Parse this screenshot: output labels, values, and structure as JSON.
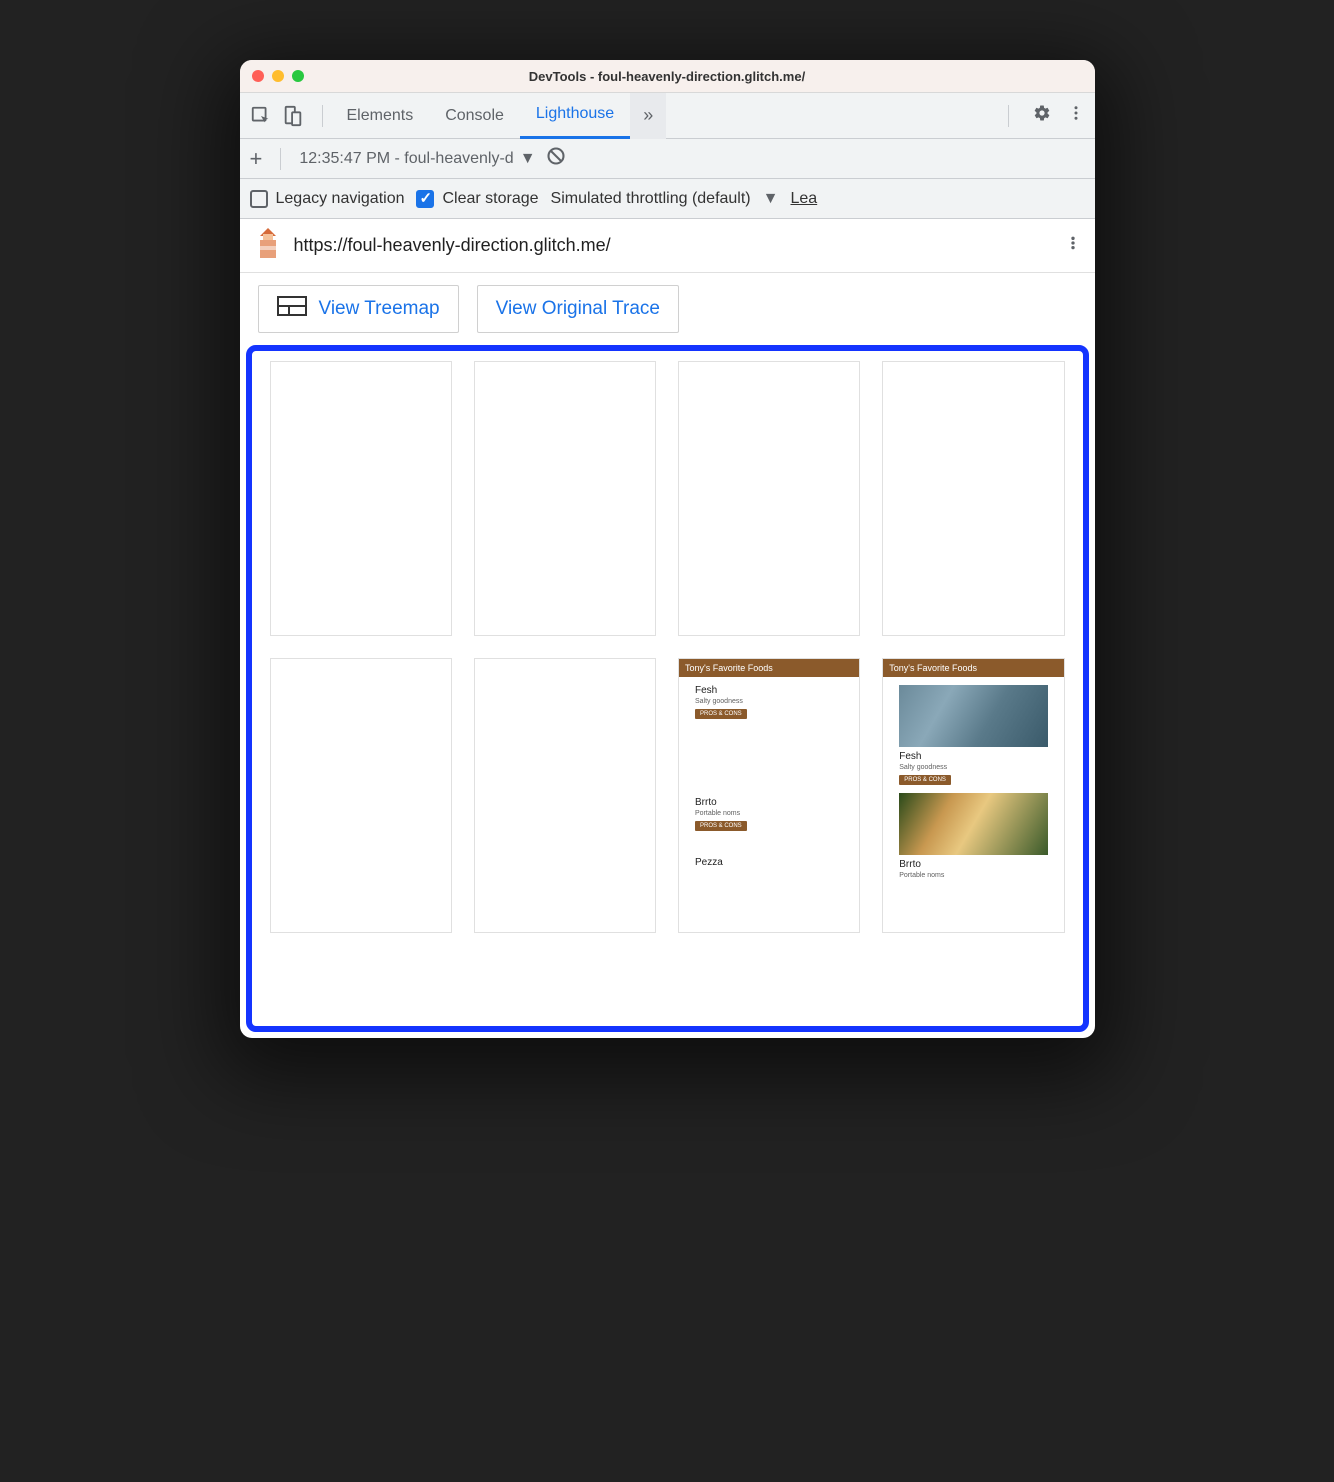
{
  "window": {
    "title": "DevTools - foul-heavenly-direction.glitch.me/"
  },
  "tabs": {
    "elements": "Elements",
    "console": "Console",
    "lighthouse": "Lighthouse",
    "more": "»"
  },
  "reportbar": {
    "selected": "12:35:47 PM - foul-heavenly-d"
  },
  "options": {
    "legacy_label": "Legacy navigation",
    "clear_label": "Clear storage",
    "throttling_label": "Simulated throttling (default)",
    "learn": "Lea"
  },
  "url": "https://foul-heavenly-direction.glitch.me/",
  "actions": {
    "treemap": "View Treemap",
    "trace": "View Original Trace"
  },
  "filmstrip": {
    "header": "Tony's Favorite Foods",
    "items": [
      {
        "title": "Fesh",
        "sub": "Salty goodness",
        "btn": "PROS & CONS"
      },
      {
        "title": "Brrto",
        "sub": "Portable noms",
        "btn": "PROS & CONS"
      },
      {
        "title": "Pezza",
        "sub": "",
        "btn": ""
      }
    ]
  }
}
